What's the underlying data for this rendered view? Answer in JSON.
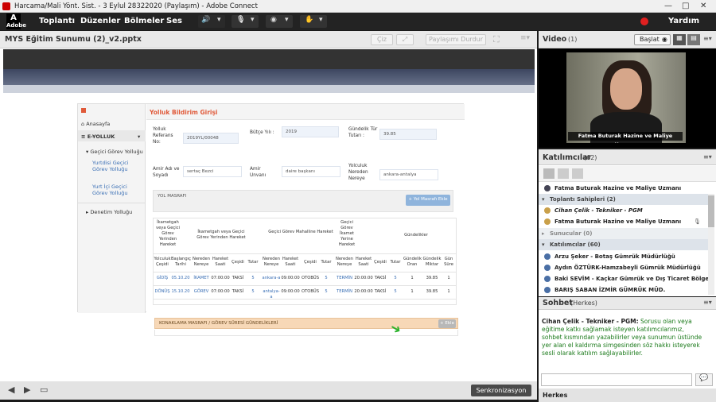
{
  "window": {
    "title": "Harcama/Mali Yönt. Sist. - 3 Eylul 28322020 (Paylaşım) - Adobe Connect"
  },
  "menubar": {
    "logo": "Adobe",
    "items": [
      "Toplantı",
      "Düzenler",
      "Bölmeler",
      "Ses"
    ],
    "help": "Yardım"
  },
  "share_pod": {
    "title": "MYS Eğitim Sunumu (2)_v2.pptx",
    "draw_label": "Çiz",
    "stop_label": "Paylaşımı Durdur",
    "sync_label": "Senkronizasyon"
  },
  "app": {
    "title": "Yolluk Bildirim Girişi",
    "nav": {
      "home": "Anasayfa",
      "section": "E-YOLLUK",
      "group": "Geçici Görev Yolluğu",
      "sub1": "Yurtdisi Geçici Görev Yolluğu",
      "sub2": "Yurt İçi Geçici Görev Yolluğu",
      "other": "Denetim Yolluğu"
    },
    "labels": {
      "ref": "Yolluk Referans No:",
      "budget": "Bütçe Yılı :",
      "daily": "Gündelik Tür Tutarı :",
      "name": "Amir Adı ve Soyadı",
      "title": "Amir Unvanı",
      "route": "Yolculuk Nereden Nereye"
    },
    "values": {
      "ref": "2019YL/00048",
      "budget": "2019",
      "daily": "39.85",
      "name": "sertaç Bezci",
      "title": "daire başkanı",
      "route": "ankara-antalya"
    },
    "road_section": "YOL MASRAFI",
    "road_button": "+ Yol Masrafı Ekle",
    "table_groups": [
      "İkametgah veya Geçici Görev Yerinden Hareket",
      "İkametgah veya Geçici Görev Yerinden Hareket",
      "Geçici Görev Mahalline Hareket",
      "Geçici Görev İkamet Yerine Hareket",
      "Gündelikler"
    ],
    "table_headers": [
      "Yolculuk Çeşidi",
      "Başlangıç Tarihi",
      "Nereden Nereye",
      "Hareket Saati",
      "Çeşidi",
      "Tutar",
      "Nereden Nereye",
      "Hareket Saati",
      "Çeşidi",
      "Tutar",
      "Nereden Nereye",
      "Hareket Saati",
      "Çeşidi",
      "Tutar",
      "Gündelik Oran",
      "Gündelik Miktar",
      "Gün Süre"
    ],
    "rows": [
      [
        "GİDİŞ",
        "05.10.20",
        "İKAMET",
        "07:00:00",
        "TAKSİ",
        "5",
        "ankara-a",
        "09:00:00",
        "OTOBÜS",
        "5",
        "TERMİN",
        "20:00:00",
        "TAKSİ",
        "5",
        "1",
        "39.85",
        "1"
      ],
      [
        "DÖNÜŞ",
        "15.10.20",
        "GÖREV",
        "07:00:00",
        "TAKSİ",
        "5",
        "antalya-a",
        "09:00:00",
        "OTOBÜS",
        "5",
        "TERMİN",
        "20:00:00",
        "TAKSİ",
        "5",
        "1",
        "39.85",
        "1"
      ]
    ],
    "lodging_section": "KONAKLAMA MASRAFI / GÖREV SÜRESİ GÜNDELİKLERİ",
    "lodging_button": "+ Ekle"
  },
  "video": {
    "title": "Video",
    "count": "(1)",
    "start_label": "Başlat",
    "caption": "Fatma Buturak Hazine ve Maliye Uzmanı"
  },
  "attendees": {
    "title": "Katılımcılar",
    "count": "(62)",
    "me": "Fatma Buturak Hazine ve Maliye Uzmanı",
    "hosts_label": "Toplantı Sahipleri (2)",
    "hosts": [
      "Cihan Çelik - Tekniker - PGM",
      "Fatma Buturak Hazine ve Maliye Uzmanı"
    ],
    "presenters_label": "Sunucular (0)",
    "participants_label": "Katılımcılar (60)",
    "participants": [
      "Arzu Şeker - Botaş Gümrük Müdürlüğü",
      "Aydın ÖZTÜRK-Hamzabeyli Gümrük Müdürlüğü",
      "Baki SEVİM - Kaçkar Gümrük ve Dış Ticaret Bölge Mü...",
      "BARIŞ SABAN İZMİR GÜMRÜK MÜD."
    ]
  },
  "chat": {
    "title": "Sohbet",
    "scope": "(Herkes)",
    "sender": "Cihan Çelik - Tekniker - PGM:",
    "message": "Sorusu olan veya eğitime katkı sağlamak isteyen katılımcılarımız, sohbet kısmından yazabilirler veya sunumun üstünde yer alan el kaldırma simgesinden söz hakkı isteyerek sesli olarak katılım sağlayabilirler.",
    "footer": "Herkes"
  },
  "colors": {
    "accent_red": "#e05a3a",
    "link_blue": "#3a6fb5",
    "chat_green": "#1b7a1b",
    "record": "#e02020"
  }
}
